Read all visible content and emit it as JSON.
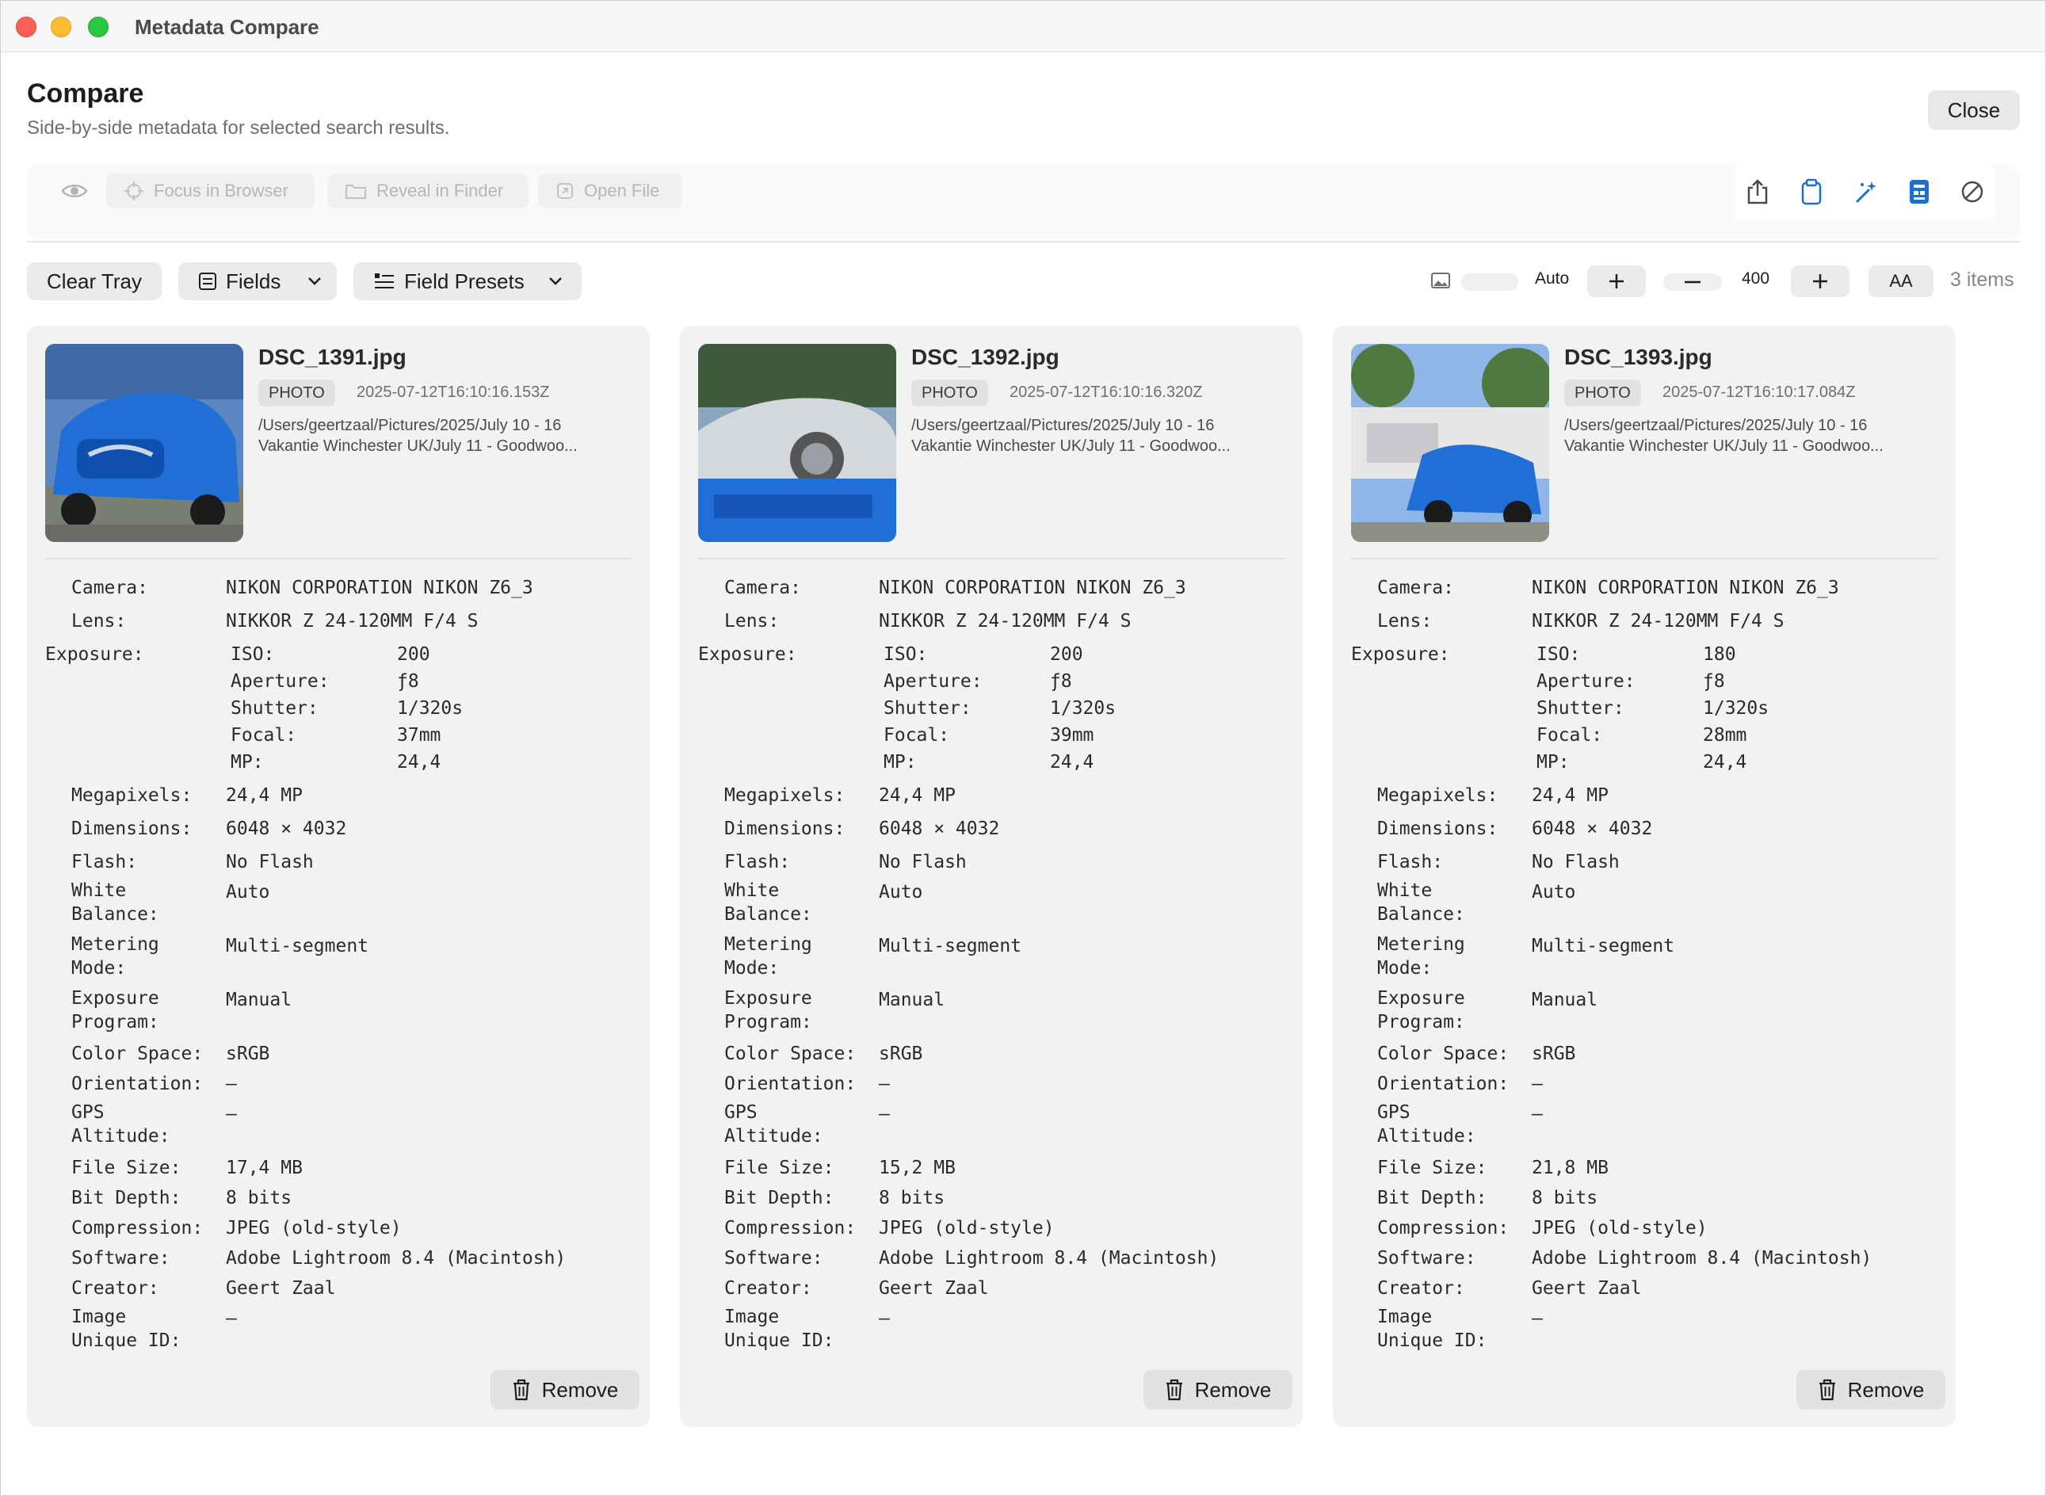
{
  "window": {
    "title": "Metadata Compare"
  },
  "header": {
    "title": "Compare",
    "subtitle": "Side-by-side metadata for selected search results.",
    "close_label": "Close"
  },
  "actions": {
    "focus_label": "Focus in Browser",
    "reveal_label": "Reveal in Finder",
    "open_label": "Open File"
  },
  "toolbar_icons": [
    "share-icon",
    "clipboard-icon",
    "magic-wand-icon",
    "id-card-icon",
    "prohibited-icon"
  ],
  "controls": {
    "clear_tray": "Clear Tray",
    "fields": "Fields",
    "field_presets": "Field Presets",
    "thumb_size_value": "Auto",
    "width_value": "400",
    "font_size_label": "AA",
    "items_count": "3 items"
  },
  "labels": {
    "camera": "Camera:",
    "lens": "Lens:",
    "exposure": "Exposure:",
    "iso": "ISO:",
    "aperture": "Aperture:",
    "shutter": "Shutter:",
    "focal": "Focal:",
    "mp": "MP:",
    "megapixels": "Megapixels:",
    "dimensions": "Dimensions:",
    "flash": "Flash:",
    "white_balance_1": "White",
    "white_balance_2": "Balance:",
    "metering_1": "Metering",
    "metering_2": "Mode:",
    "exposure_program_1": "Exposure",
    "exposure_program_2": "Program:",
    "color_space": "Color Space:",
    "orientation": "Orientation:",
    "gps_altitude_1": "GPS",
    "gps_altitude_2": "Altitude:",
    "file_size": "File Size:",
    "bit_depth": "Bit Depth:",
    "compression": "Compression:",
    "software": "Software:",
    "creator": "Creator:",
    "image_unique_id_1": "Image",
    "image_unique_id_2": "Unique ID:",
    "remove": "Remove"
  },
  "cards": [
    {
      "filename": "DSC_1391.jpg",
      "type": "PHOTO",
      "timestamp": "2025-07-12T16:10:16.153Z",
      "path_line1": "/Users/geertzaal/Pictures/2025/July 10 - 16",
      "path_line2": "Vakantie Winchester UK/July 11 - Goodwoo...",
      "camera": "NIKON CORPORATION NIKON Z6_3",
      "lens": "NIKKOR Z 24-120MM F/4 S",
      "iso": "200",
      "aperture": "ƒ8",
      "shutter": "1/320s",
      "focal": "37mm",
      "mp": "24,4",
      "megapixels": "24,4 MP",
      "dimensions": "6048 × 4032",
      "flash": "No Flash",
      "white_balance": "Auto",
      "metering": "Multi-segment",
      "exposure_program": "Manual",
      "color_space": "sRGB",
      "orientation": "—",
      "gps_altitude": "—",
      "file_size": "17,4 MB",
      "bit_depth": "8 bits",
      "compression": "JPEG (old-style)",
      "software": "Adobe Lightroom 8.4 (Macintosh)",
      "creator": "Geert Zaal",
      "image_unique_id": "—"
    },
    {
      "filename": "DSC_1392.jpg",
      "type": "PHOTO",
      "timestamp": "2025-07-12T16:10:16.320Z",
      "path_line1": "/Users/geertzaal/Pictures/2025/July 10 - 16",
      "path_line2": "Vakantie Winchester UK/July 11 - Goodwoo...",
      "camera": "NIKON CORPORATION NIKON Z6_3",
      "lens": "NIKKOR Z 24-120MM F/4 S",
      "iso": "200",
      "aperture": "ƒ8",
      "shutter": "1/320s",
      "focal": "39mm",
      "mp": "24,4",
      "megapixels": "24,4 MP",
      "dimensions": "6048 × 4032",
      "flash": "No Flash",
      "white_balance": "Auto",
      "metering": "Multi-segment",
      "exposure_program": "Manual",
      "color_space": "sRGB",
      "orientation": "—",
      "gps_altitude": "—",
      "file_size": "15,2 MB",
      "bit_depth": "8 bits",
      "compression": "JPEG (old-style)",
      "software": "Adobe Lightroom 8.4 (Macintosh)",
      "creator": "Geert Zaal",
      "image_unique_id": "—"
    },
    {
      "filename": "DSC_1393.jpg",
      "type": "PHOTO",
      "timestamp": "2025-07-12T16:10:17.084Z",
      "path_line1": "/Users/geertzaal/Pictures/2025/July 10 - 16",
      "path_line2": "Vakantie Winchester UK/July 11 - Goodwoo...",
      "camera": "NIKON CORPORATION NIKON Z6_3",
      "lens": "NIKKOR Z 24-120MM F/4 S",
      "iso": "180",
      "aperture": "ƒ8",
      "shutter": "1/320s",
      "focal": "28mm",
      "mp": "24,4",
      "megapixels": "24,4 MP",
      "dimensions": "6048 × 4032",
      "flash": "No Flash",
      "white_balance": "Auto",
      "metering": "Multi-segment",
      "exposure_program": "Manual",
      "color_space": "sRGB",
      "orientation": "—",
      "gps_altitude": "—",
      "file_size": "21,8 MB",
      "bit_depth": "8 bits",
      "compression": "JPEG (old-style)",
      "software": "Adobe Lightroom 8.4 (Macintosh)",
      "creator": "Geert Zaal",
      "image_unique_id": "—"
    }
  ],
  "colors": {
    "accent": "#1a6fd1",
    "card_bg": "#f2f2f2",
    "car_blue": "#1f6fd6"
  }
}
